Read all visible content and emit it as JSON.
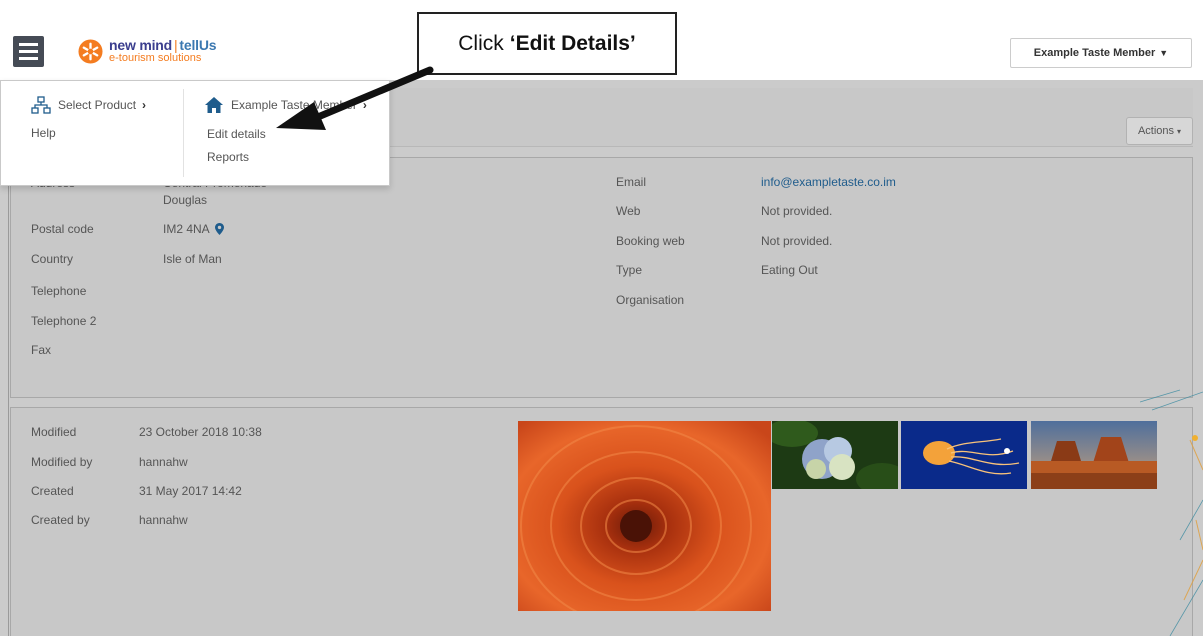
{
  "header": {
    "logo": {
      "brand_a": "new mind",
      "separator": "|",
      "brand_b": "tellUs",
      "tagline": "e-tourism solutions"
    },
    "member_button": {
      "label": "Example Taste Member",
      "caret": "▼"
    }
  },
  "menu": {
    "col1": [
      {
        "label": "Select Product",
        "icon": "sitemap-icon",
        "chevron": "›"
      },
      {
        "label": "Help"
      }
    ],
    "col2": [
      {
        "label": "Example Taste Member",
        "icon": "home-icon",
        "chevron": "›"
      },
      {
        "label": "Edit details"
      },
      {
        "label": "Reports"
      }
    ]
  },
  "callout": {
    "prefix": "Click",
    "emphasis": "‘Edit Details’"
  },
  "actions": {
    "label": "Actions",
    "caret": "▾"
  },
  "contact": {
    "address_label": "Address",
    "address_line1": "Central Promenade",
    "address_line2": "Douglas",
    "postal_code_label": "Postal code",
    "postal_code": "IM2 4NA",
    "country_label": "Country",
    "country": "Isle of Man",
    "telephone_label": "Telephone",
    "telephone2_label": "Telephone 2",
    "fax_label": "Fax",
    "email_label": "Email",
    "email": "info@exampletaste.co.im",
    "web_label": "Web",
    "web": "Not provided.",
    "booking_web_label": "Booking web",
    "booking_web": "Not provided.",
    "type_label": "Type",
    "type": "Eating Out",
    "organisation_label": "Organisation"
  },
  "meta": {
    "modified_label": "Modified",
    "modified": "23 October 2018 10:38",
    "modified_by_label": "Modified by",
    "modified_by": "hannahw",
    "created_label": "Created",
    "created": "31 May 2017 14:42",
    "created_by_label": "Created by",
    "created_by": "hannahw"
  },
  "photos": [
    "chrysanthemum-image",
    "hydrangea-image",
    "jellyfish-image",
    "desert-image"
  ],
  "colors": {
    "accent": "#1f5c8c",
    "logo_orange": "#f47c20",
    "logo_navy": "#3b3e8e",
    "overlay": "#cbcbcb"
  }
}
